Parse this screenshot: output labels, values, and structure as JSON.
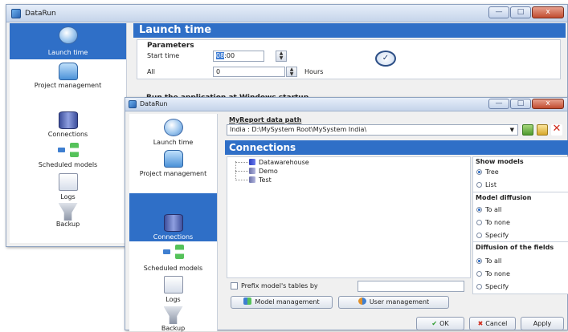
{
  "back_window": {
    "title": "DataRun",
    "controls": {
      "minimize": "—",
      "maximize": "□",
      "close": "x"
    },
    "nav": [
      {
        "label": "Launch time",
        "icon": "clock-icon",
        "selected": true
      },
      {
        "label": "Project management",
        "icon": "folder-icon",
        "selected": false
      },
      {
        "label": "Connections",
        "icon": "database-icon",
        "selected": false
      },
      {
        "label": "Scheduled models",
        "icon": "scheduled-models-icon",
        "selected": false
      },
      {
        "label": "Logs",
        "icon": "logs-icon",
        "selected": false
      },
      {
        "label": "Backup",
        "icon": "backup-icon",
        "selected": false
      }
    ],
    "header": "Launch time",
    "parameters": {
      "heading": "Parameters",
      "start_time_label": "Start time",
      "start_time_hour": "08",
      "start_time_rest": ":00",
      "all_label": "All",
      "all_value": "0",
      "hours_label": "Hours"
    },
    "startup_text": "Run the application at Windows startup"
  },
  "front_window": {
    "title": "DataRun",
    "controls": {
      "minimize": "—",
      "maximize": "□",
      "close": "x"
    },
    "nav": [
      {
        "label": "Launch time",
        "icon": "clock-icon",
        "selected": false
      },
      {
        "label": "Project management",
        "icon": "folder-icon",
        "selected": false
      },
      {
        "label": "Connections",
        "icon": "database-icon",
        "selected": true
      },
      {
        "label": "Scheduled models",
        "icon": "scheduled-models-icon",
        "selected": false
      },
      {
        "label": "Logs",
        "icon": "logs-icon",
        "selected": false
      },
      {
        "label": "Backup",
        "icon": "backup-icon",
        "selected": false
      }
    ],
    "data_path": {
      "label": "MyReport data path",
      "value": "India : D:\\MySystem Root\\MySystem India\\"
    },
    "header": "Connections",
    "tree": [
      "Datawarehouse",
      "Demo",
      "Test"
    ],
    "show_models": {
      "heading": "Show models",
      "options": [
        "Tree",
        "List"
      ],
      "selected": "Tree"
    },
    "model_diffusion": {
      "heading": "Model diffusion",
      "options": [
        "To all",
        "To none",
        "Specify"
      ],
      "selected": "To all"
    },
    "fields_diffusion": {
      "heading": "Diffusion of the fields",
      "options": [
        "To all",
        "To none",
        "Specify"
      ],
      "selected": "To all"
    },
    "prefix_label": "Prefix model's tables by",
    "prefix_value": "",
    "buttons": {
      "model_management": "Model management",
      "user_management": "User management",
      "ok": "OK",
      "cancel": "Cancel",
      "apply": "Apply"
    }
  },
  "colors": {
    "accent": "#2f6fc7",
    "titlebar": "#c5d4ea"
  }
}
